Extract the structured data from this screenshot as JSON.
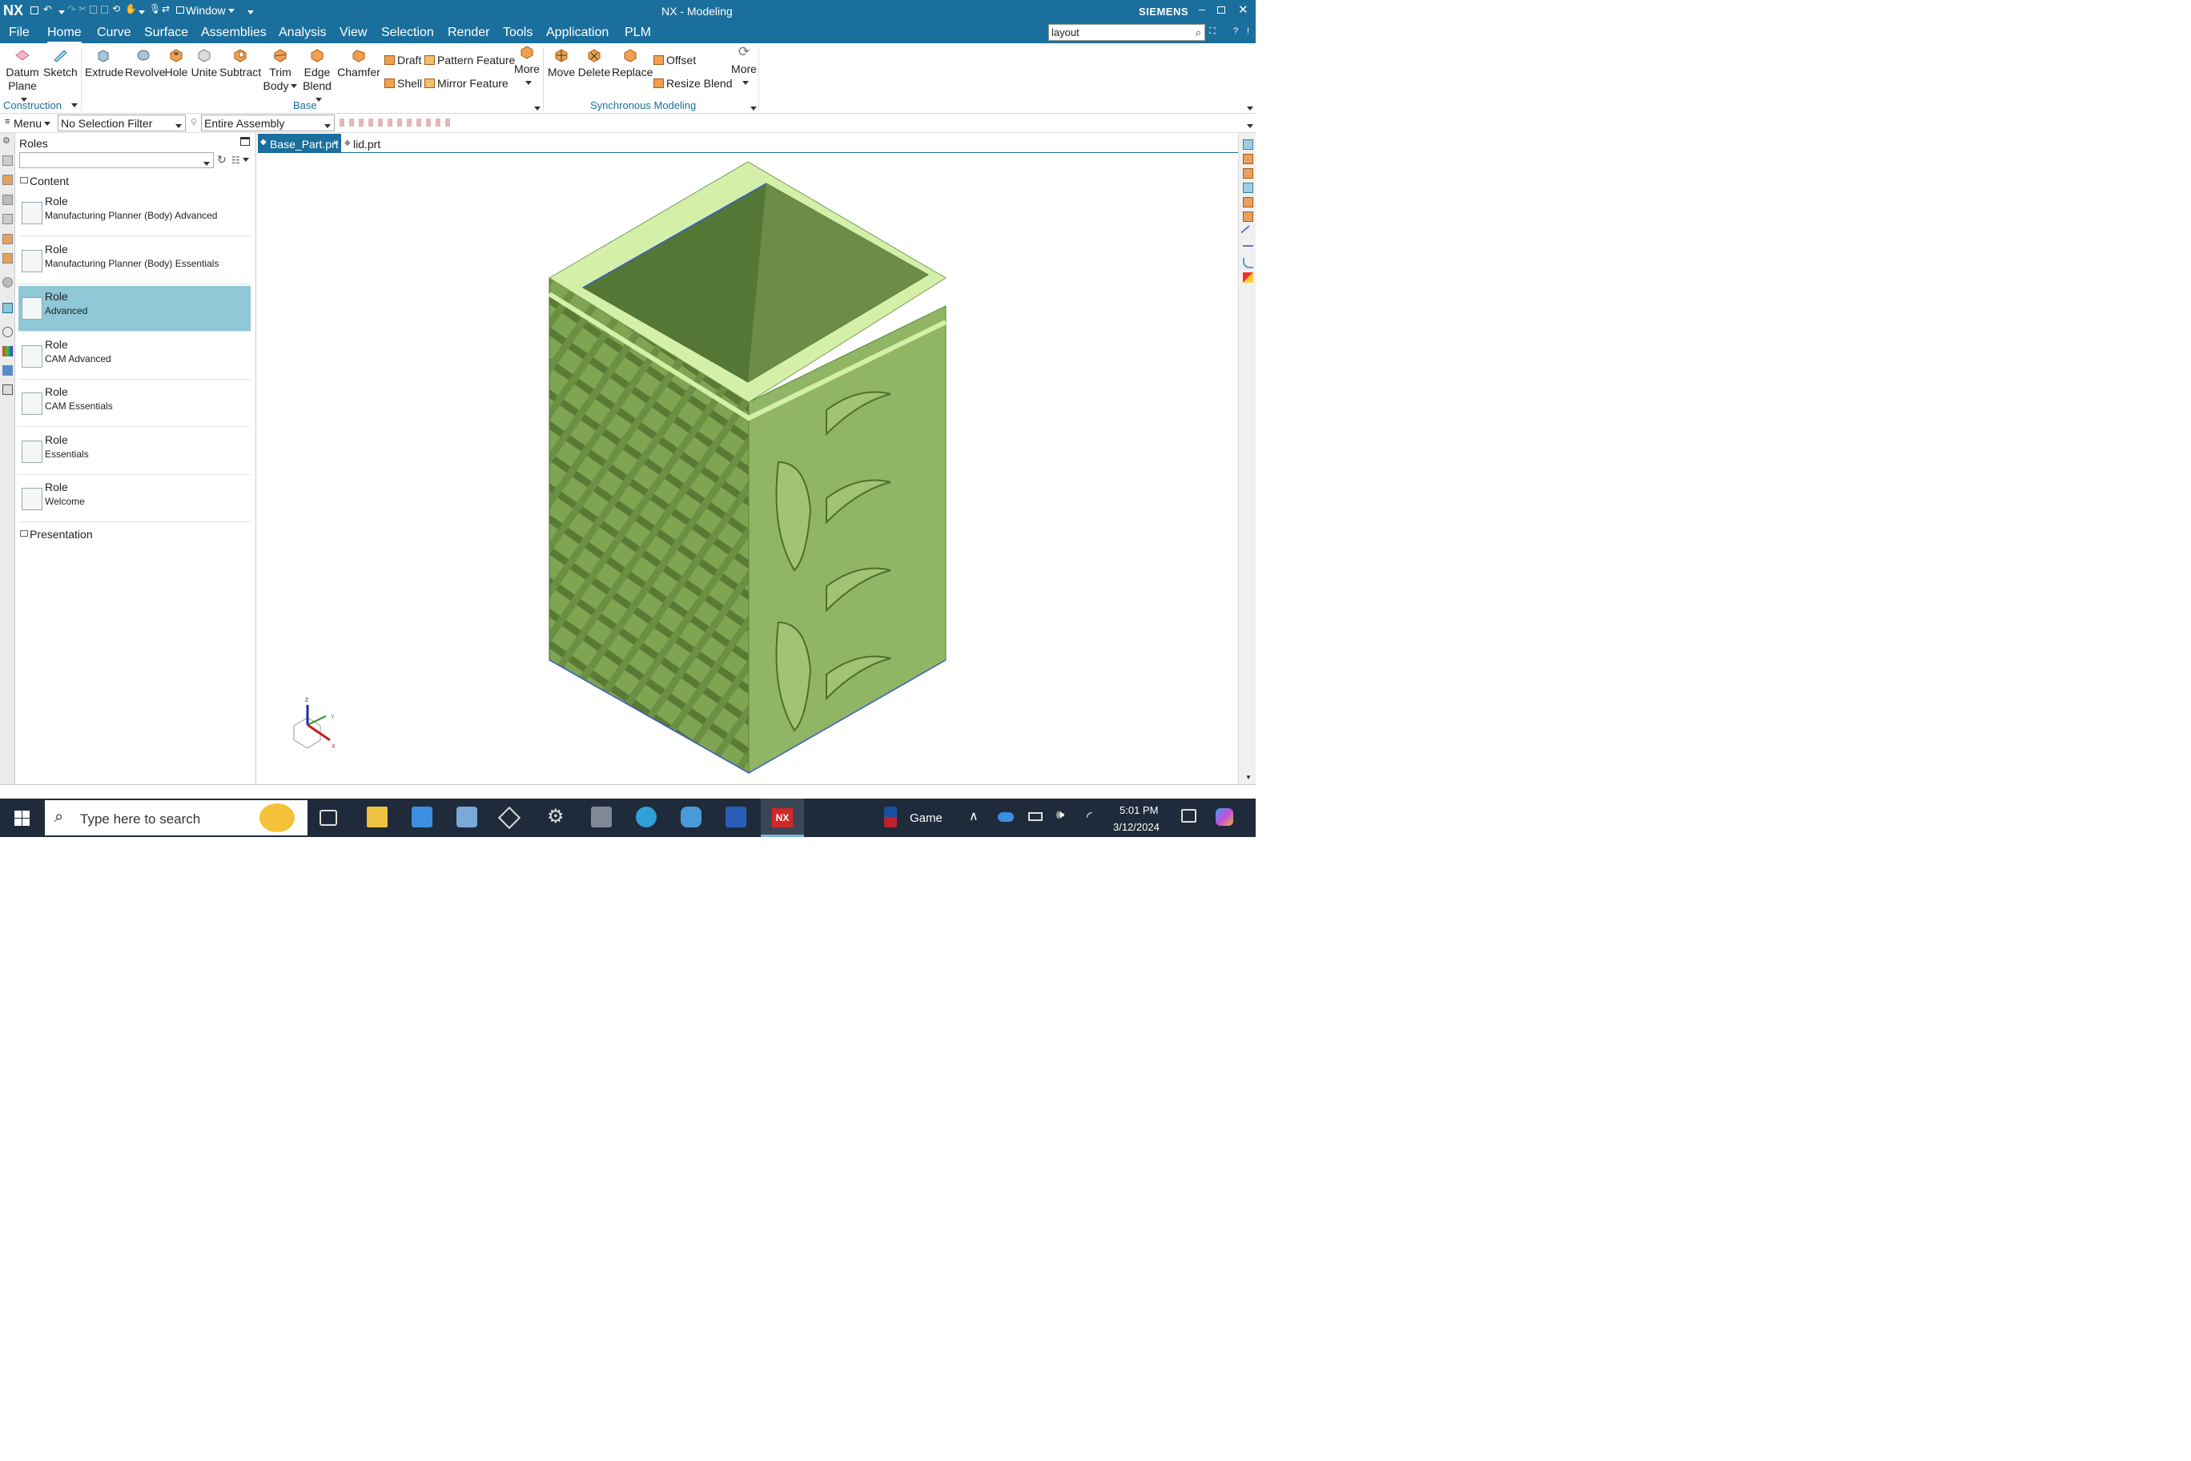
{
  "app": {
    "logo": "NX",
    "title": "NX - Modeling",
    "brand": "SIEMENS",
    "window_menu": "Window"
  },
  "menubar": {
    "items": [
      "File",
      "Home",
      "Curve",
      "Surface",
      "Assemblies",
      "Analysis",
      "View",
      "Selection",
      "Render",
      "Tools",
      "Application",
      "PLM"
    ],
    "active": "Home",
    "search_value": "layout"
  },
  "ribbon": {
    "construction": {
      "datum_l1": "Datum",
      "datum_l2": "Plane",
      "sketch": "Sketch",
      "group": "Construction"
    },
    "base": {
      "extrude": "Extrude",
      "revolve": "Revolve",
      "hole": "Hole",
      "unite": "Unite",
      "subtract": "Subtract",
      "trim_l1": "Trim",
      "trim_l2": "Body",
      "edge_l1": "Edge",
      "edge_l2": "Blend",
      "chamfer": "Chamfer",
      "draft": "Draft",
      "shell": "Shell",
      "pattern": "Pattern Feature",
      "mirror": "Mirror Feature",
      "more": "More",
      "group": "Base"
    },
    "sync": {
      "move": "Move",
      "delete": "Delete",
      "replace": "Replace",
      "offset": "Offset",
      "resize_blend": "Resize Blend",
      "more": "More",
      "group": "Synchronous Modeling"
    }
  },
  "selection_bar": {
    "menu": "Menu",
    "filter": "No Selection Filter",
    "scope": "Entire Assembly"
  },
  "nav": {
    "title": "Roles",
    "content_folder": "Content",
    "presentation_folder": "Presentation",
    "roles": [
      {
        "t1": "Role",
        "t2": "Manufacturing Planner (Body) Advanced"
      },
      {
        "t1": "Role",
        "t2": "Manufacturing Planner (Body) Essentials"
      },
      {
        "t1": "Role",
        "t2": "Advanced"
      },
      {
        "t1": "Role",
        "t2": "CAM Advanced"
      },
      {
        "t1": "Role",
        "t2": "CAM Essentials"
      },
      {
        "t1": "Role",
        "t2": "Essentials"
      },
      {
        "t1": "Role",
        "t2": "Welcome"
      }
    ],
    "selected_role": "Advanced"
  },
  "tabs": [
    {
      "label": "Base_Part.prt",
      "active": true,
      "close": "×"
    },
    {
      "label": "lid.prt",
      "active": false
    }
  ],
  "triad": {
    "z": "Z",
    "y": "Y",
    "x": "X"
  },
  "taskbar": {
    "search_placeholder": "Type here to search",
    "game_label": "Game",
    "time": "5:01 PM",
    "date": "3/12/2024",
    "nx_label": "NX"
  },
  "colors": {
    "titlebar": "#1a6f9c",
    "model_face": "#90b665",
    "model_top": "#d4f0a8",
    "selected_role": "#8fc8d6"
  }
}
